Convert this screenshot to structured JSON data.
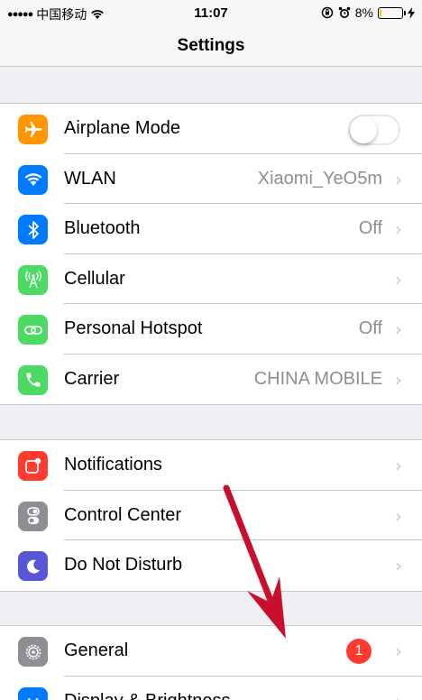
{
  "status_bar": {
    "signal": "●●●●●",
    "carrier": "中国移动",
    "time": "11:07",
    "battery_percent": "8%",
    "battery_level": 0.08
  },
  "nav": {
    "title": "Settings"
  },
  "colors": {
    "airplane": "#ff9500",
    "wlan": "#007aff",
    "bluetooth": "#007aff",
    "cellular": "#4cd964",
    "hotspot": "#4cd964",
    "carrier": "#4cd964",
    "notifications": "#ff3b30",
    "control_center": "#8e8e93",
    "do_not_disturb": "#5856d6",
    "general": "#8e8e93",
    "display": "#007aff",
    "badge": "#ff3b30",
    "annotation_arrow": "#c8102e"
  },
  "group1": {
    "airplane_mode": {
      "label": "Airplane Mode",
      "icon": "airplane-icon",
      "toggle_on": false
    },
    "wlan": {
      "label": "WLAN",
      "value": "Xiaomi_YeO5m",
      "icon": "wifi-icon"
    },
    "bluetooth": {
      "label": "Bluetooth",
      "value": "Off",
      "icon": "bluetooth-icon"
    },
    "cellular": {
      "label": "Cellular",
      "icon": "cellular-antenna-icon"
    },
    "personal_hotspot": {
      "label": "Personal Hotspot",
      "value": "Off",
      "icon": "hotspot-icon"
    },
    "carrier": {
      "label": "Carrier",
      "value": "CHINA MOBILE",
      "icon": "phone-icon"
    }
  },
  "group2": {
    "notifications": {
      "label": "Notifications",
      "icon": "notifications-icon"
    },
    "control_center": {
      "label": "Control Center",
      "icon": "control-center-icon"
    },
    "do_not_disturb": {
      "label": "Do Not Disturb",
      "icon": "moon-icon"
    }
  },
  "group3": {
    "general": {
      "label": "General",
      "badge": "1",
      "icon": "gear-icon"
    },
    "display_brightness": {
      "label": "Display & Brightness",
      "icon": "display-icon"
    }
  }
}
